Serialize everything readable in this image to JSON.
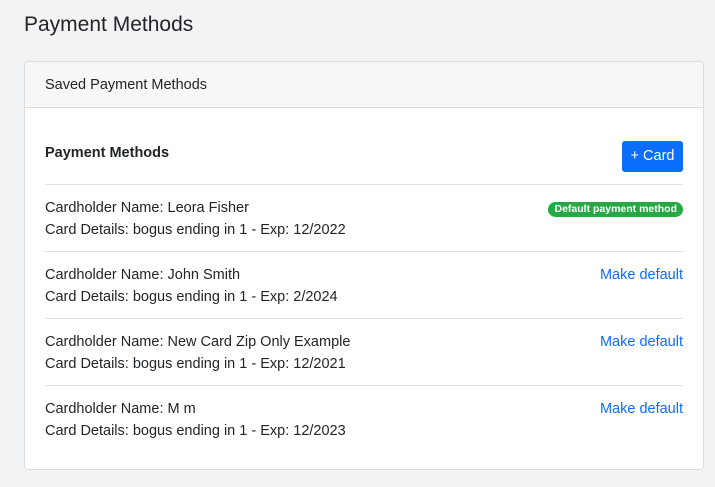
{
  "page": {
    "title": "Payment Methods"
  },
  "card": {
    "header": "Saved Payment Methods",
    "section_title": "Payment Methods",
    "add_button_label": "+ Card"
  },
  "methods": [
    {
      "holder": "Cardholder Name: Leora Fisher",
      "details": "Card Details: bogus ending in 1 - Exp: 12/2022",
      "is_default": true,
      "badge": "Default payment method"
    },
    {
      "holder": "Cardholder Name: John Smith",
      "details": "Card Details: bogus ending in 1 - Exp: 2/2024",
      "is_default": false,
      "action": "Make default"
    },
    {
      "holder": "Cardholder Name: New Card Zip Only Example",
      "details": "Card Details: bogus ending in 1 - Exp: 12/2021",
      "is_default": false,
      "action": "Make default"
    },
    {
      "holder": "Cardholder Name: M m",
      "details": "Card Details: bogus ending in 1 - Exp: 12/2023",
      "is_default": false,
      "action": "Make default"
    }
  ],
  "colors": {
    "primary": "#0d6efd",
    "success_badge": "#28a745",
    "page_background": "#f2f3f5"
  }
}
